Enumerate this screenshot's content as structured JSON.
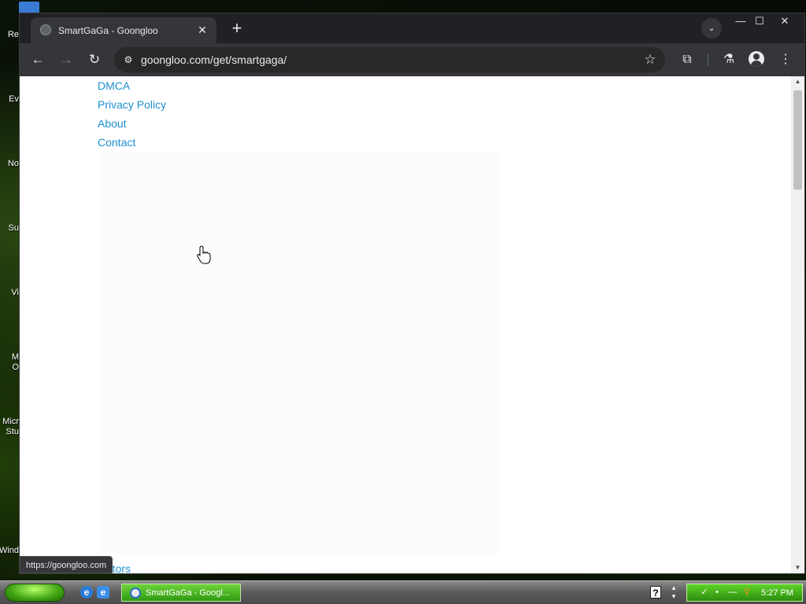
{
  "desktop": {
    "labels": [
      "Re",
      "Ev",
      "No",
      "Su",
      "Vi",
      "M\nO",
      "Micr\nStu",
      "Wind"
    ]
  },
  "browser": {
    "tab": {
      "title": "SmartGaGa - Goongloo",
      "close_glyph": "✕"
    },
    "new_tab_glyph": "+",
    "tab_search_glyph": "⌄",
    "window_controls": {
      "minimize": "—",
      "maximize": "☐",
      "close": "✕"
    },
    "toolbar": {
      "back": "←",
      "forward": "→",
      "reload": "↻",
      "site_info": "⚙",
      "url": "goongloo.com/get/smartgaga/",
      "bookmark": "☆",
      "extensions": "⧉",
      "labs": "⚗",
      "menu": "⋮"
    }
  },
  "page": {
    "footer_links": [
      "DMCA",
      "Privacy Policy",
      "About",
      "Contact"
    ],
    "partial_link": "ulators",
    "status_url": "https://goongloo.com"
  },
  "taskbar": {
    "quick_launch": [
      "e",
      "e"
    ],
    "task_button": "SmartGaGa - Googl...",
    "help": "?",
    "clock": "5:27 PM",
    "colors": {
      "start": "#3fa312",
      "tray": "#2b8d0e"
    }
  }
}
